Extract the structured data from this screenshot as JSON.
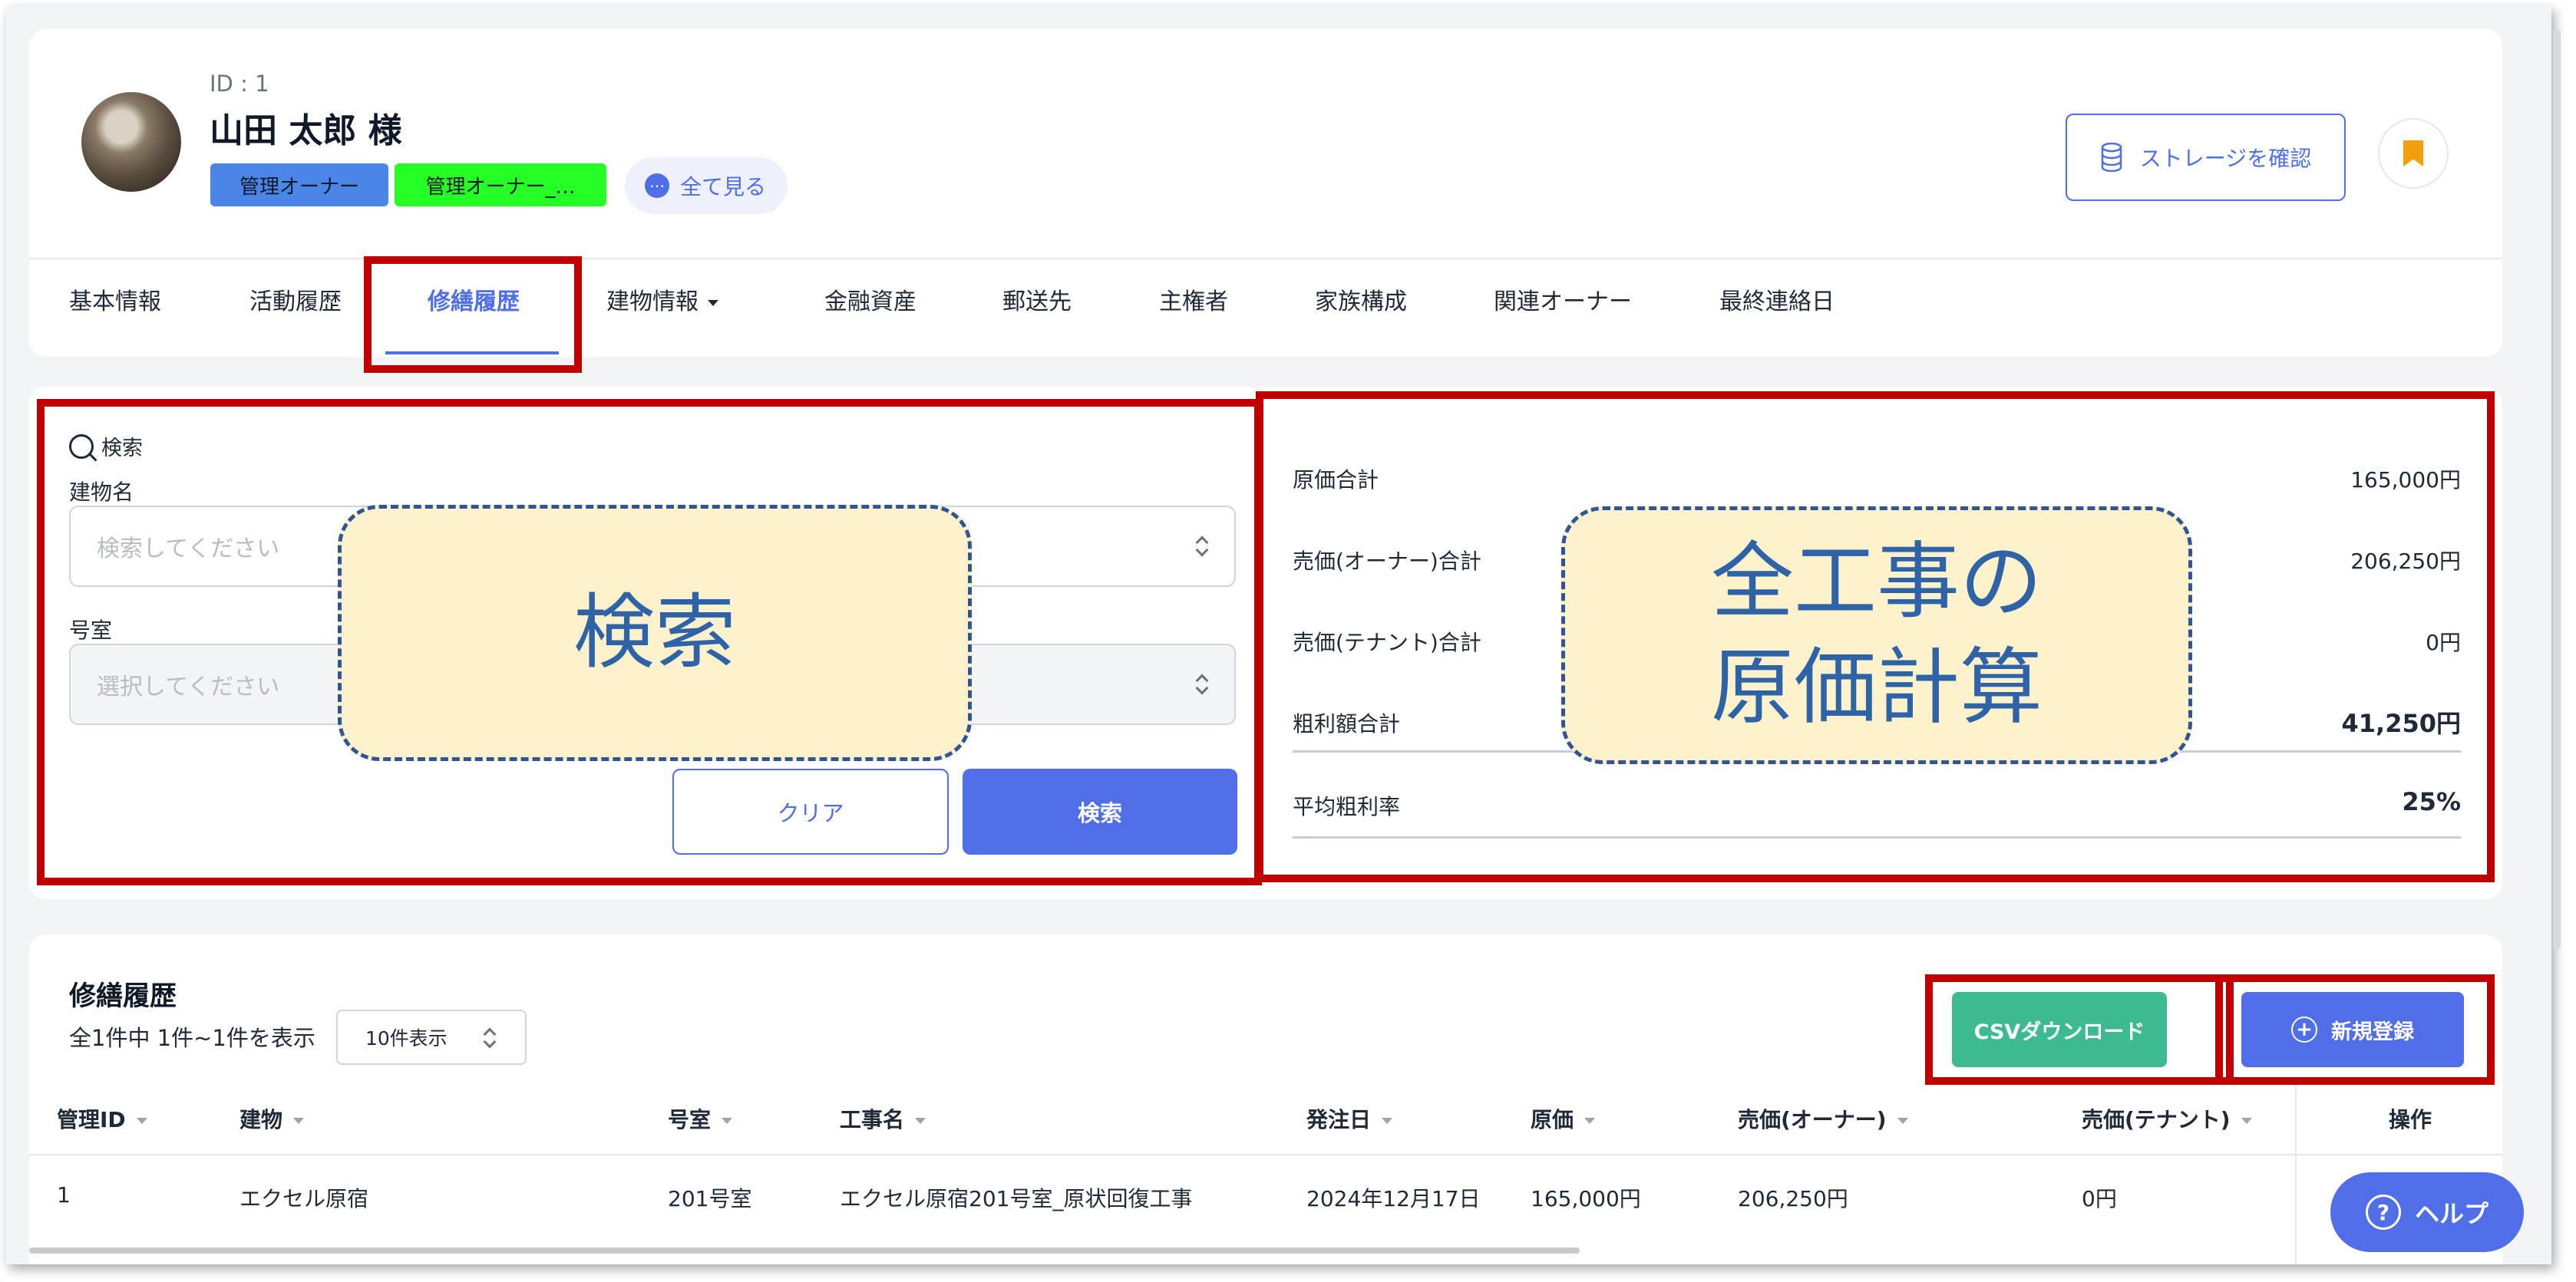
{
  "owner": {
    "id_label": "ID : 1",
    "name": "山田 太郎 様",
    "tags": [
      "管理オーナー",
      "管理オーナー_…"
    ],
    "see_all": "全て見る"
  },
  "header_actions": {
    "storage_label": "ストレージを確認"
  },
  "tabs": [
    {
      "label": "基本情報"
    },
    {
      "label": "活動履歴"
    },
    {
      "label": "修繕履歴",
      "active": true
    },
    {
      "label": "建物情報"
    },
    {
      "label": "金融資産"
    },
    {
      "label": "郵送先"
    },
    {
      "label": "主権者"
    },
    {
      "label": "家族構成"
    },
    {
      "label": "関連オーナー"
    },
    {
      "label": "最終連絡日"
    }
  ],
  "search": {
    "title": "検索",
    "building_label": "建物名",
    "building_placeholder": "検索してください",
    "room_label": "号室",
    "room_placeholder": "選択してください",
    "clear_label": "クリア",
    "search_label": "検索"
  },
  "summary": {
    "rows": [
      {
        "label": "原価合計",
        "value": "165,000円"
      },
      {
        "label": "売価(オーナー)合計",
        "value": "206,250円"
      },
      {
        "label": "売価(テナント)合計",
        "value": "0円"
      },
      {
        "label": "粗利額合計",
        "value": "41,250円"
      }
    ],
    "avg_label": "平均粗利率",
    "avg_value": "25%"
  },
  "callouts": {
    "search": "検索",
    "cost_line1": "全工事の",
    "cost_line2": "原価計算"
  },
  "table": {
    "title": "修繕履歴",
    "count_text": "全1件中 1件~1件を表示",
    "page_size": "10件表示",
    "csv_label": "CSVダウンロード",
    "new_label": "新規登録",
    "columns": [
      "管理ID",
      "建物",
      "号室",
      "工事名",
      "発注日",
      "原価",
      "売価(オーナー)",
      "売価(テナント)",
      "操作"
    ],
    "rows": [
      [
        "1",
        "エクセル原宿",
        "201号室",
        "エクセル原宿201号室_原状回復工事",
        "2024年12月17日",
        "165,000円",
        "206,250円",
        "0円"
      ]
    ]
  },
  "help_label": "ヘルプ",
  "colors": {
    "accent": "#4f6ee8",
    "annotation_red": "#c00000",
    "callout_fill": "#fef2cd",
    "csv_green": "#3dba8f"
  }
}
